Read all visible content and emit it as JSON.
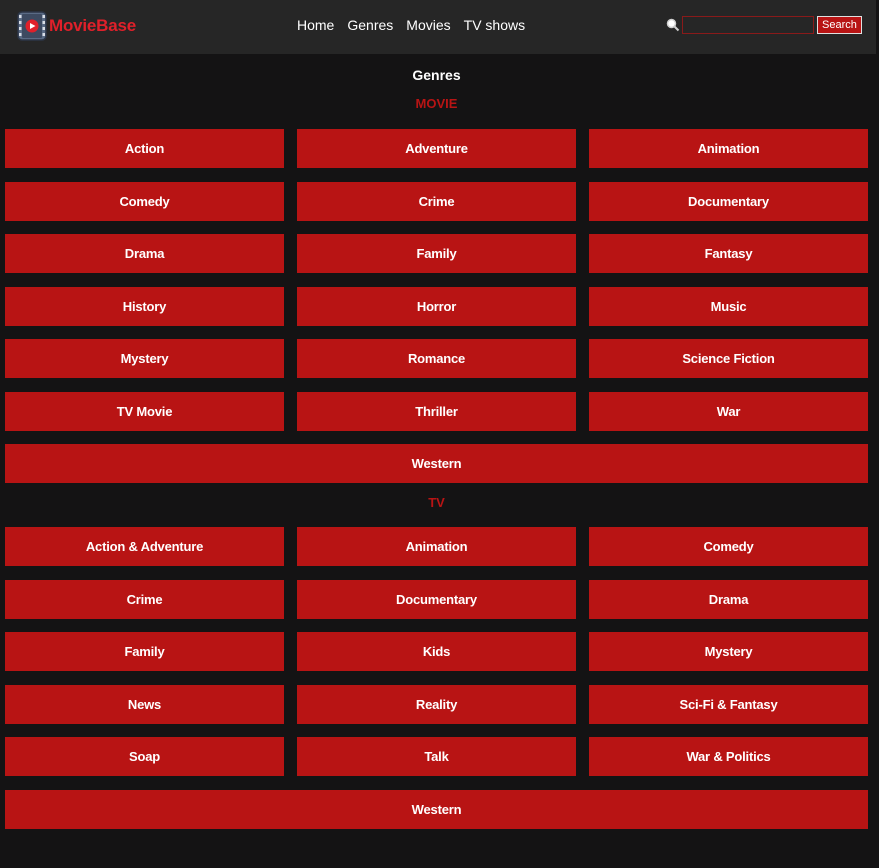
{
  "brand": {
    "name": "MovieBase",
    "logo_icon": "film-reel-play-icon",
    "accent_color": "#e0202a"
  },
  "nav": {
    "items": [
      "Home",
      "Genres",
      "Movies",
      "TV shows"
    ]
  },
  "search": {
    "icon": "magnifier-icon",
    "value": "",
    "placeholder": "",
    "button_label": "Search"
  },
  "page": {
    "title": "Genres"
  },
  "movie": {
    "title": "MOVIE",
    "genres": [
      "Action",
      "Adventure",
      "Animation",
      "Comedy",
      "Crime",
      "Documentary",
      "Drama",
      "Family",
      "Fantasy",
      "History",
      "Horror",
      "Music",
      "Mystery",
      "Romance",
      "Science Fiction",
      "TV Movie",
      "Thriller",
      "War",
      "Western"
    ]
  },
  "tv": {
    "title": "TV",
    "genres": [
      "Action & Adventure",
      "Animation",
      "Comedy",
      "Crime",
      "Documentary",
      "Drama",
      "Family",
      "Kids",
      "Mystery",
      "News",
      "Reality",
      "Sci-Fi & Fantasy",
      "Soap",
      "Talk",
      "War & Politics",
      "Western"
    ]
  },
  "colors": {
    "background": "#141314",
    "header": "#262626",
    "button": "#b81414"
  }
}
